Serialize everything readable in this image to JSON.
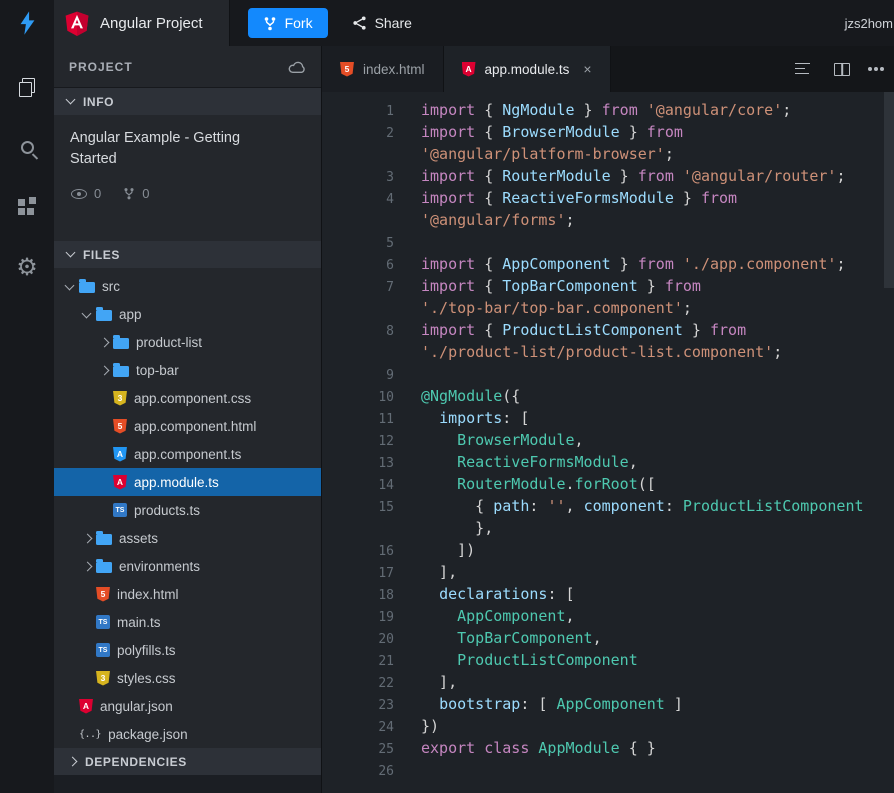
{
  "colors": {
    "accent_blue": "#1389fd",
    "selection_blue": "#1464a8",
    "angular_red": "#dd0031",
    "folder_blue": "#42a5f5",
    "html_orange": "#e44d26",
    "css_gold": "#d6b41f",
    "ts_blue": "#3178c6"
  },
  "header": {
    "project_title": "Angular Project",
    "fork_button": "Fork",
    "share_button": "Share",
    "username": "jzs2hom"
  },
  "activity_bar": {
    "icons": [
      "files-icon",
      "search-icon",
      "extensions-icon",
      "settings-gear-icon"
    ]
  },
  "sidebar": {
    "panel_title": "PROJECT",
    "info_section": {
      "label": "INFO",
      "description": "Angular Example - Getting Started",
      "views_count": "0",
      "forks_count": "0"
    },
    "files_section": {
      "label": "FILES"
    },
    "dependencies_section": {
      "label": "DEPENDENCIES"
    },
    "tree": [
      {
        "name": "src",
        "icon": "folder-icon",
        "kind": "folder",
        "depth": 0,
        "expanded": true
      },
      {
        "name": "app",
        "icon": "folder-icon",
        "kind": "folder",
        "depth": 1,
        "expanded": true
      },
      {
        "name": "product-list",
        "icon": "folder-icon",
        "kind": "folder",
        "depth": 2,
        "expanded": false
      },
      {
        "name": "top-bar",
        "icon": "folder-icon",
        "kind": "folder",
        "depth": 2,
        "expanded": false
      },
      {
        "name": "app.component.css",
        "icon": "css-icon",
        "kind": "file",
        "depth": 2
      },
      {
        "name": "app.component.html",
        "icon": "html-icon",
        "kind": "file",
        "depth": 2
      },
      {
        "name": "app.component.ts",
        "icon": "angular-ts-icon",
        "kind": "file",
        "depth": 2
      },
      {
        "name": "app.module.ts",
        "icon": "angular-icon",
        "kind": "file",
        "depth": 2,
        "selected": true
      },
      {
        "name": "products.ts",
        "icon": "ts-icon",
        "kind": "file",
        "depth": 2
      },
      {
        "name": "assets",
        "icon": "folder-icon",
        "kind": "folder",
        "depth": 1,
        "expanded": false
      },
      {
        "name": "environments",
        "icon": "folder-icon",
        "kind": "folder",
        "depth": 1,
        "expanded": false
      },
      {
        "name": "index.html",
        "icon": "html-icon",
        "kind": "file",
        "depth": 1
      },
      {
        "name": "main.ts",
        "icon": "ts-icon",
        "kind": "file",
        "depth": 1
      },
      {
        "name": "polyfills.ts",
        "icon": "ts-icon",
        "kind": "file",
        "depth": 1
      },
      {
        "name": "styles.css",
        "icon": "css-icon",
        "kind": "file",
        "depth": 1
      },
      {
        "name": "angular.json",
        "icon": "angular-icon",
        "kind": "file",
        "depth": 0
      },
      {
        "name": "package.json",
        "icon": "json-icon",
        "kind": "file",
        "depth": 0
      }
    ]
  },
  "editor": {
    "tabs": [
      {
        "label": "index.html",
        "icon": "html-icon",
        "active": false
      },
      {
        "label": "app.module.ts",
        "icon": "angular-icon",
        "active": true,
        "close": "×"
      }
    ],
    "rows": [
      {
        "n": "1",
        "t": [
          [
            "kw",
            "import"
          ],
          [
            "pun",
            " { "
          ],
          [
            "id",
            "NgModule"
          ],
          [
            "pun",
            " } "
          ],
          [
            "kw",
            "from"
          ],
          [
            "pun",
            " "
          ],
          [
            "str",
            "'@angular/core'"
          ],
          [
            "pun",
            ";"
          ]
        ]
      },
      {
        "n": "2",
        "t": [
          [
            "kw",
            "import"
          ],
          [
            "pun",
            " { "
          ],
          [
            "id",
            "BrowserModule"
          ],
          [
            "pun",
            " } "
          ],
          [
            "kw",
            "from"
          ]
        ]
      },
      {
        "n": "",
        "t": [
          [
            "str",
            "'@angular/platform-browser'"
          ],
          [
            "pun",
            ";"
          ]
        ]
      },
      {
        "n": "3",
        "t": [
          [
            "kw",
            "import"
          ],
          [
            "pun",
            " { "
          ],
          [
            "id",
            "RouterModule"
          ],
          [
            "pun",
            " } "
          ],
          [
            "kw",
            "from"
          ],
          [
            "pun",
            " "
          ],
          [
            "str",
            "'@angular/router'"
          ],
          [
            "pun",
            ";"
          ]
        ]
      },
      {
        "n": "4",
        "t": [
          [
            "kw",
            "import"
          ],
          [
            "pun",
            " { "
          ],
          [
            "id",
            "ReactiveFormsModule"
          ],
          [
            "pun",
            " } "
          ],
          [
            "kw",
            "from"
          ]
        ]
      },
      {
        "n": "",
        "t": [
          [
            "str",
            "'@angular/forms'"
          ],
          [
            "pun",
            ";"
          ]
        ]
      },
      {
        "n": "5",
        "t": []
      },
      {
        "n": "6",
        "t": [
          [
            "kw",
            "import"
          ],
          [
            "pun",
            " { "
          ],
          [
            "id",
            "AppComponent"
          ],
          [
            "pun",
            " } "
          ],
          [
            "kw",
            "from"
          ],
          [
            "pun",
            " "
          ],
          [
            "str",
            "'./app.component'"
          ],
          [
            "pun",
            ";"
          ]
        ]
      },
      {
        "n": "7",
        "t": [
          [
            "kw",
            "import"
          ],
          [
            "pun",
            " { "
          ],
          [
            "id",
            "TopBarComponent"
          ],
          [
            "pun",
            " } "
          ],
          [
            "kw",
            "from"
          ]
        ]
      },
      {
        "n": "",
        "t": [
          [
            "str",
            "'./top-bar/top-bar.component'"
          ],
          [
            "pun",
            ";"
          ]
        ]
      },
      {
        "n": "8",
        "t": [
          [
            "kw",
            "import"
          ],
          [
            "pun",
            " { "
          ],
          [
            "id",
            "ProductListComponent"
          ],
          [
            "pun",
            " } "
          ],
          [
            "kw",
            "from"
          ]
        ]
      },
      {
        "n": "",
        "t": [
          [
            "str",
            "'./product-list/product-list.component'"
          ],
          [
            "pun",
            ";"
          ]
        ]
      },
      {
        "n": "9",
        "t": []
      },
      {
        "n": "10",
        "t": [
          [
            "dec",
            "@NgModule"
          ],
          [
            "pun",
            "({"
          ]
        ]
      },
      {
        "n": "11",
        "t": [
          [
            "pun",
            "  "
          ],
          [
            "id",
            "imports"
          ],
          [
            "pun",
            ": ["
          ]
        ]
      },
      {
        "n": "12",
        "t": [
          [
            "pun",
            "    "
          ],
          [
            "type",
            "BrowserModule"
          ],
          [
            "pun",
            ","
          ]
        ]
      },
      {
        "n": "13",
        "t": [
          [
            "pun",
            "    "
          ],
          [
            "type",
            "ReactiveFormsModule"
          ],
          [
            "pun",
            ","
          ]
        ]
      },
      {
        "n": "14",
        "t": [
          [
            "pun",
            "    "
          ],
          [
            "type",
            "RouterModule"
          ],
          [
            "pun",
            "."
          ],
          [
            "type",
            "forRoot"
          ],
          [
            "pun",
            "(["
          ]
        ]
      },
      {
        "n": "15",
        "t": [
          [
            "pun",
            "      { "
          ],
          [
            "id",
            "path"
          ],
          [
            "pun",
            ": "
          ],
          [
            "str",
            "''"
          ],
          [
            "pun",
            ", "
          ],
          [
            "id",
            "component"
          ],
          [
            "pun",
            ": "
          ],
          [
            "type",
            "ProductListComponent"
          ]
        ]
      },
      {
        "n": "",
        "t": [
          [
            "pun",
            "      },"
          ]
        ]
      },
      {
        "n": "16",
        "t": [
          [
            "pun",
            "    ])"
          ]
        ]
      },
      {
        "n": "17",
        "t": [
          [
            "pun",
            "  ],"
          ]
        ]
      },
      {
        "n": "18",
        "t": [
          [
            "pun",
            "  "
          ],
          [
            "id",
            "declarations"
          ],
          [
            "pun",
            ": ["
          ]
        ]
      },
      {
        "n": "19",
        "t": [
          [
            "pun",
            "    "
          ],
          [
            "type",
            "AppComponent"
          ],
          [
            "pun",
            ","
          ]
        ]
      },
      {
        "n": "20",
        "t": [
          [
            "pun",
            "    "
          ],
          [
            "type",
            "TopBarComponent"
          ],
          [
            "pun",
            ","
          ]
        ]
      },
      {
        "n": "21",
        "t": [
          [
            "pun",
            "    "
          ],
          [
            "type",
            "ProductListComponent"
          ]
        ]
      },
      {
        "n": "22",
        "t": [
          [
            "pun",
            "  ],"
          ]
        ]
      },
      {
        "n": "23",
        "t": [
          [
            "pun",
            "  "
          ],
          [
            "id",
            "bootstrap"
          ],
          [
            "pun",
            ": [ "
          ],
          [
            "type",
            "AppComponent"
          ],
          [
            "pun",
            " ]"
          ]
        ]
      },
      {
        "n": "24",
        "t": [
          [
            "pun",
            "})"
          ]
        ]
      },
      {
        "n": "25",
        "t": [
          [
            "kw",
            "export"
          ],
          [
            "pun",
            " "
          ],
          [
            "kw",
            "class"
          ],
          [
            "pun",
            " "
          ],
          [
            "type",
            "AppModule"
          ],
          [
            "pun",
            " { }"
          ]
        ]
      },
      {
        "n": "26",
        "t": []
      }
    ]
  }
}
